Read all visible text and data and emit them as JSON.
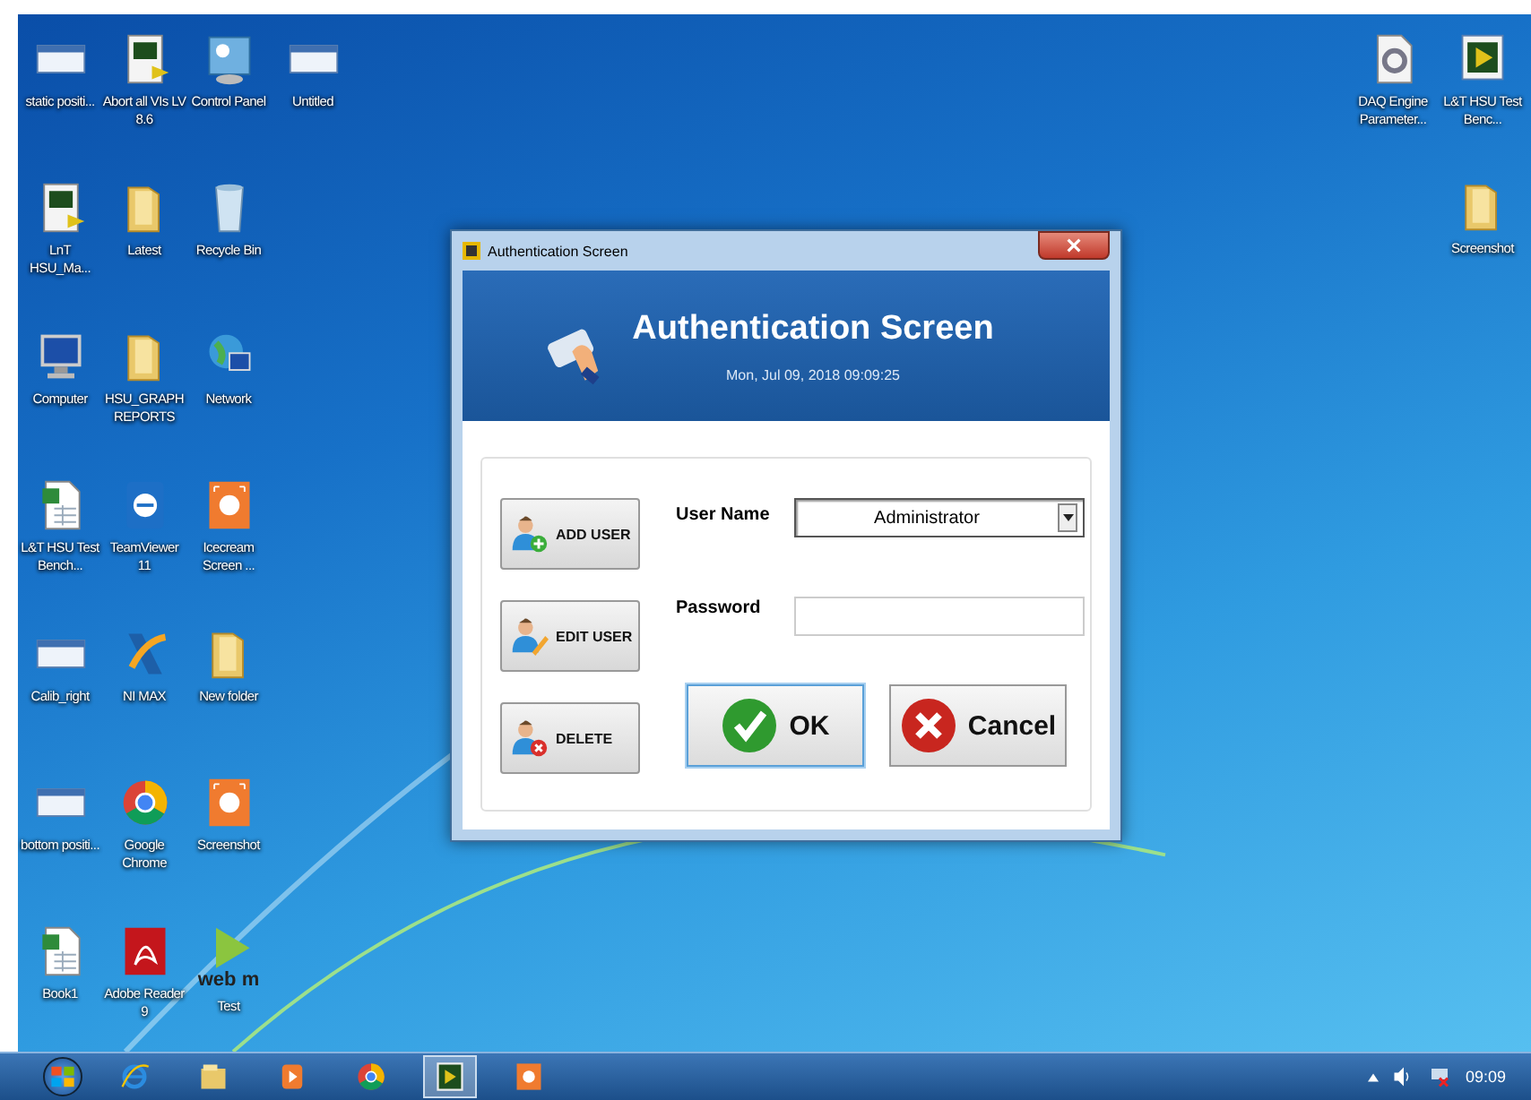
{
  "desktop": {
    "left_rows": [
      [
        {
          "label": "static positi...",
          "kind": "window"
        },
        {
          "label": "Abort all VIs LV 8.6",
          "kind": "vi"
        },
        {
          "label": "Control Panel",
          "kind": "panel"
        },
        {
          "label": "Untitled",
          "kind": "window"
        }
      ],
      [
        {
          "label": "LnT HSU_Ma...",
          "kind": "vi"
        },
        {
          "label": "Latest",
          "kind": "folder"
        },
        {
          "label": "Recycle Bin",
          "kind": "bin"
        }
      ],
      [
        {
          "label": "Computer",
          "kind": "computer"
        },
        {
          "label": "HSU_GRAPH REPORTS",
          "kind": "folder"
        },
        {
          "label": "Network",
          "kind": "network"
        }
      ],
      [
        {
          "label": "L&T HSU Test Bench...",
          "kind": "sheet"
        },
        {
          "label": "TeamViewer 11",
          "kind": "teamviewer"
        },
        {
          "label": "Icecream Screen ...",
          "kind": "icecream"
        }
      ],
      [
        {
          "label": "Calib_right",
          "kind": "window"
        },
        {
          "label": "NI MAX",
          "kind": "nimax"
        },
        {
          "label": "New folder",
          "kind": "folder"
        }
      ],
      [
        {
          "label": "bottom positi...",
          "kind": "window"
        },
        {
          "label": "Google Chrome",
          "kind": "chrome"
        },
        {
          "label": "Screenshot",
          "kind": "icecream"
        }
      ],
      [
        {
          "label": "Book1",
          "kind": "sheet"
        },
        {
          "label": "Adobe Reader 9",
          "kind": "pdf"
        },
        {
          "label": "Test",
          "kind": "webm",
          "icon_text": "web m"
        }
      ]
    ],
    "right_rows": [
      [
        {
          "label": "DAQ Engine Parameter...",
          "kind": "gear"
        },
        {
          "label": "L&T HSU Test Benc...",
          "kind": "vi"
        }
      ],
      [
        {
          "label": "Screenshot",
          "kind": "folder"
        }
      ]
    ]
  },
  "dialog": {
    "title": "Authentication Screen",
    "heading": "Authentication Screen",
    "datetime": "Mon, Jul 09, 2018 09:09:25",
    "side_buttons": [
      {
        "label": "ADD USER",
        "kind": "add"
      },
      {
        "label": "EDIT USER",
        "kind": "edit"
      },
      {
        "label": "DELETE",
        "kind": "delete"
      }
    ],
    "user_name": {
      "label": "User Name",
      "value": "Administrator"
    },
    "password": {
      "label": "Password"
    },
    "ok_button": "OK",
    "cancel_button": "Cancel"
  },
  "taskbar": {
    "apps": [
      {
        "kind": "ie",
        "selected": false
      },
      {
        "kind": "explorer",
        "selected": false
      },
      {
        "kind": "media",
        "selected": false
      },
      {
        "kind": "chrome",
        "selected": false
      },
      {
        "kind": "vi",
        "selected": true
      },
      {
        "kind": "icecream",
        "selected": false
      }
    ],
    "clock": "09:09"
  }
}
